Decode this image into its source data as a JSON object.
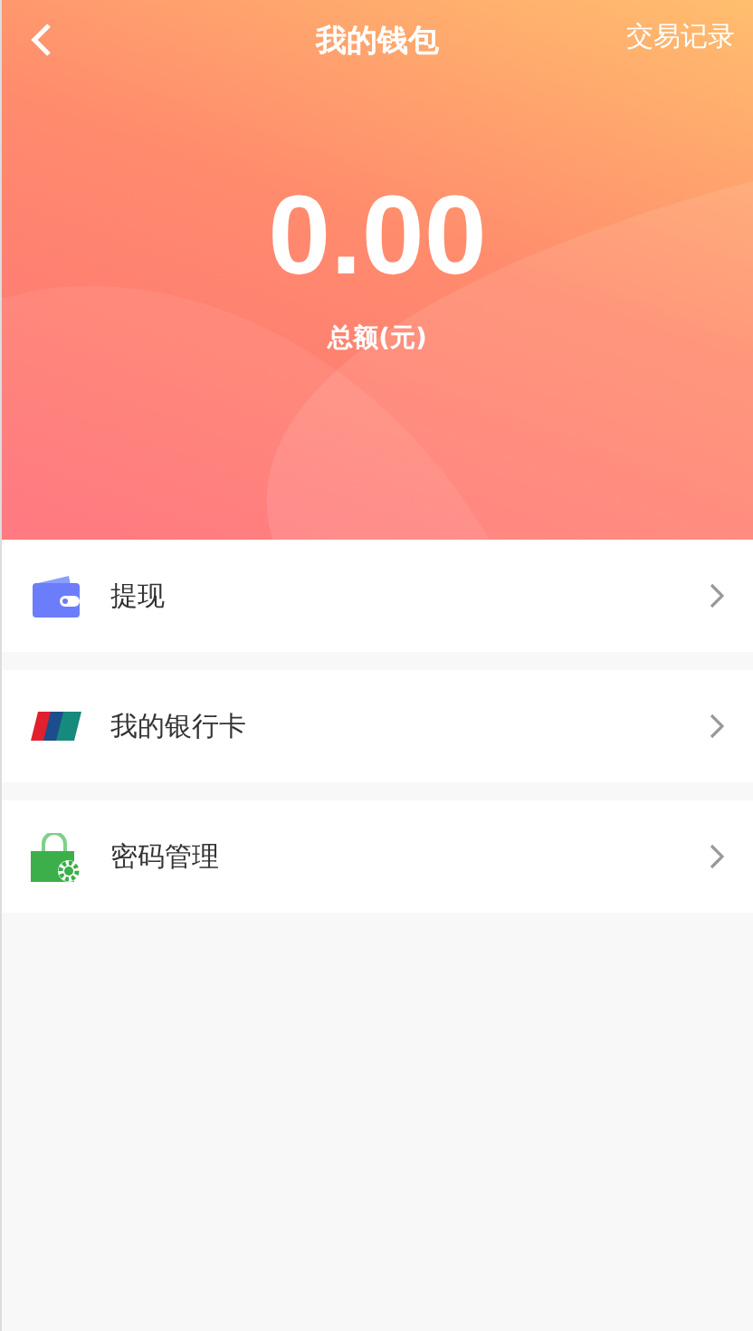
{
  "nav": {
    "title": "我的钱包",
    "action": "交易记录"
  },
  "balance": {
    "amount": "0.00",
    "label": "总额(元)"
  },
  "menu": [
    {
      "kind": "wallet",
      "label": "提现"
    },
    {
      "kind": "card",
      "label": "我的银行卡"
    },
    {
      "kind": "lock",
      "label": "密码管理"
    }
  ]
}
